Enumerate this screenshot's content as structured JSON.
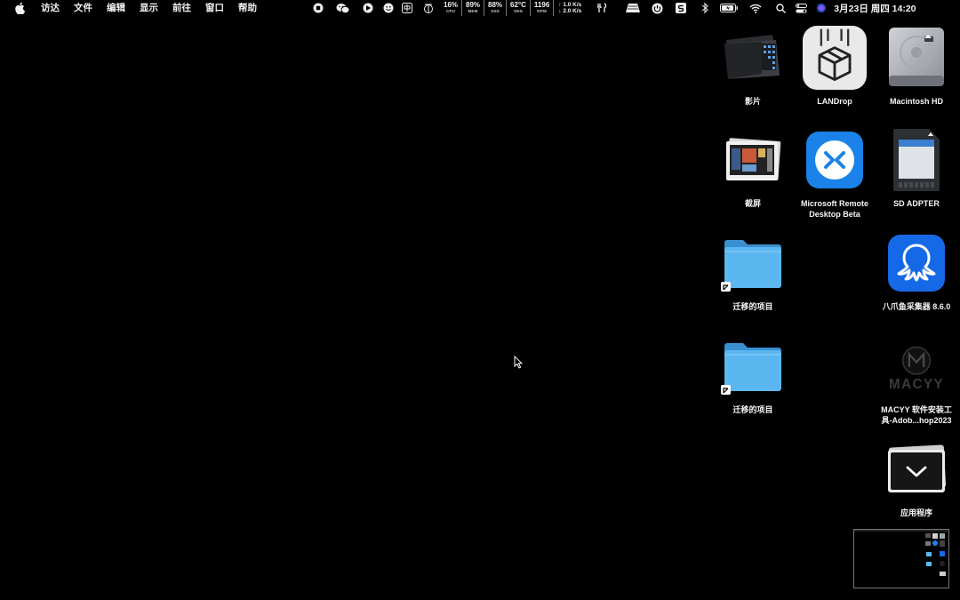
{
  "menubar": {
    "apple_icon": "apple-logo-icon",
    "menus": [
      "访达",
      "文件",
      "编辑",
      "显示",
      "前往",
      "窗口",
      "帮助"
    ],
    "stats": [
      {
        "value": "16%",
        "label": "CPU"
      },
      {
        "value": "89%",
        "label": "MEM"
      },
      {
        "value": "88%",
        "label": "SSD"
      },
      {
        "value": "62°C",
        "label": "SEN"
      },
      {
        "value": "1196",
        "label": "RPM"
      }
    ],
    "network": {
      "up": "↑ 1.0 K/s",
      "down": "↓ 2.0 K/s"
    },
    "clock": "3月23日 周四  14:20"
  },
  "desktop": {
    "icons": [
      {
        "id": "movies",
        "label": "影片",
        "icon": "movies-folder-icon"
      },
      {
        "id": "landrop",
        "label": "LANDrop",
        "icon": "landrop-app-icon"
      },
      {
        "id": "macintosh-hd",
        "label": "Macintosh HD",
        "icon": "hard-drive-icon"
      },
      {
        "id": "screenshots",
        "label": "截屏",
        "icon": "screenshots-stack-icon"
      },
      {
        "id": "ms-remote",
        "label": "Microsoft Remote\nDesktop Beta",
        "icon": "remote-desktop-icon"
      },
      {
        "id": "sd",
        "label": "SD ADPTER",
        "icon": "sd-card-icon"
      },
      {
        "id": "migrated1",
        "label": "迁移的项目",
        "icon": "folder-alias-icon"
      },
      {
        "id": "octoparse",
        "label": "八爪鱼采集器 8.6.0",
        "icon": "octopus-app-icon"
      },
      {
        "id": "migrated2",
        "label": "迁移的项目",
        "icon": "folder-alias-icon"
      },
      {
        "id": "macyy",
        "label": "MACYY 软件安装工\n具-Adob...hop2023",
        "icon": "macyy-icon"
      },
      {
        "id": "apps",
        "label": "应用程序",
        "icon": "applications-stack-icon"
      }
    ],
    "macyy_logo_text": "MACYY"
  }
}
